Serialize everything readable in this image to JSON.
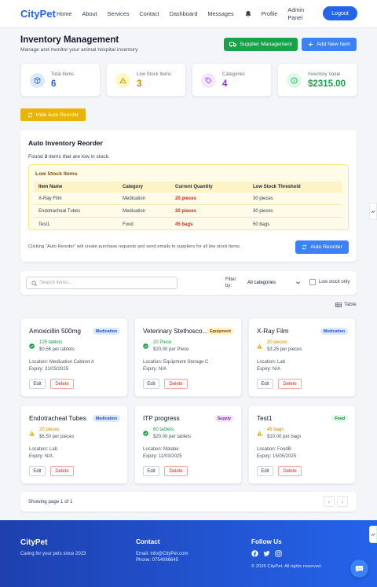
{
  "nav": {
    "logo": "CityPet",
    "links": [
      "Home",
      "About",
      "Services",
      "Contact",
      "Dashboard",
      "Messages"
    ],
    "profile": "Profile",
    "admin_line1": "Admin",
    "admin_line2": "Panel",
    "logout": "Logout"
  },
  "header": {
    "title": "Inventory Management",
    "subtitle": "Manage and monitor your animal hospital inventory",
    "supplier_btn": "Supplier Management",
    "add_btn": "Add New Item"
  },
  "stats": [
    {
      "label": "Total Items",
      "value": "6",
      "color": "#2563eb",
      "icon": "box-icon"
    },
    {
      "label": "Low Stock Items",
      "value": "3",
      "color": "#ca8a04",
      "icon": "warning-icon"
    },
    {
      "label": "Categories",
      "value": "4",
      "color": "#9333ea",
      "icon": "tag-icon"
    },
    {
      "label": "Inventory Value",
      "value": "$2315.00",
      "color": "#16a34a",
      "icon": "dollar-icon"
    }
  ],
  "hide_reorder": "Hide Auto Reorder",
  "reorder": {
    "title": "Auto Inventory Reorder",
    "found_pre": "Found ",
    "found_count": "3",
    "found_post": " items that are low in stock.",
    "box_title": "Low Stock Items",
    "headers": [
      "Item Name",
      "Category",
      "Current Quantity",
      "Low Stock Threshold"
    ],
    "rows": [
      [
        "X-Ray Film",
        "Medication",
        "20 pieces",
        "30 pieces"
      ],
      [
        "Endotracheal Tubes",
        "Medication",
        "20 pieces",
        "30 pieces"
      ],
      [
        "Test1",
        "Food",
        "45 bags",
        "50 bags"
      ]
    ],
    "note": "Clicking \"Auto Reorder\" will create purchase requests and send emails to suppliers for all low stock items.",
    "button": "Auto Reorder"
  },
  "filter": {
    "search_placeholder": "Search items...",
    "label_line1": "Filter",
    "label_line2": "by:",
    "category": "All categories",
    "low_only": "Low stock only"
  },
  "table_toggle": "Table",
  "cards": [
    {
      "name": "Amoxicillin 500mg",
      "badge": "Medication",
      "badge_type": "med",
      "qty": "125 tablets",
      "status": "ok",
      "price": "$0.56 per tablets",
      "location": "Location: Medication Cabinet A",
      "expiry": "Expiry: 31/03/2025"
    },
    {
      "name": "Veterinary Stethosco...",
      "badge": "Equipment",
      "badge_type": "equip",
      "qty": "20 Piece",
      "status": "ok",
      "price": "$20.00 per Piece",
      "location": "Location: Equipment Storage C",
      "expiry": "Expiry: N/A"
    },
    {
      "name": "X-Ray Film",
      "badge": "Medication",
      "badge_type": "med",
      "qty": "20 pieces",
      "status": "low",
      "price": "$3.25 per pieces",
      "location": "Location: Lab",
      "expiry": "Expiry: N/A"
    },
    {
      "name": "Endotracheal Tubes",
      "badge": "Medication",
      "badge_type": "med",
      "qty": "20 pieces",
      "status": "low",
      "price": "$6.50 per pieces",
      "location": "Location: Lab",
      "expiry": "Expiry: N/A"
    },
    {
      "name": "ITP progress",
      "badge": "Supply",
      "badge_type": "supply",
      "qty": "60 tablets",
      "status": "ok",
      "price": "$20.00 per tablets",
      "location": "Location: Malabe",
      "expiry": "Expiry: 11/03/2025"
    },
    {
      "name": "Test1",
      "badge": "Food",
      "badge_type": "food",
      "qty": "45 bags",
      "status": "low",
      "price": "$10.00 per bags",
      "location": "Location: FoodB",
      "expiry": "Expiry: 15/05/2025"
    }
  ],
  "card_actions": {
    "edit": "Edit",
    "delete": "Delete"
  },
  "pager": {
    "text": "Showing page 1 of 1",
    "prev": "‹",
    "next": "›"
  },
  "footer": {
    "brand": "CityPet",
    "tagline": "Caring for your pets since 2023",
    "contact_title": "Contact",
    "email": "Email: info@CityPet.com",
    "phone": "Phone: 0754086645",
    "follow_title": "Follow Us",
    "copyright": "© 2025 CityPet. All rights reserved."
  }
}
